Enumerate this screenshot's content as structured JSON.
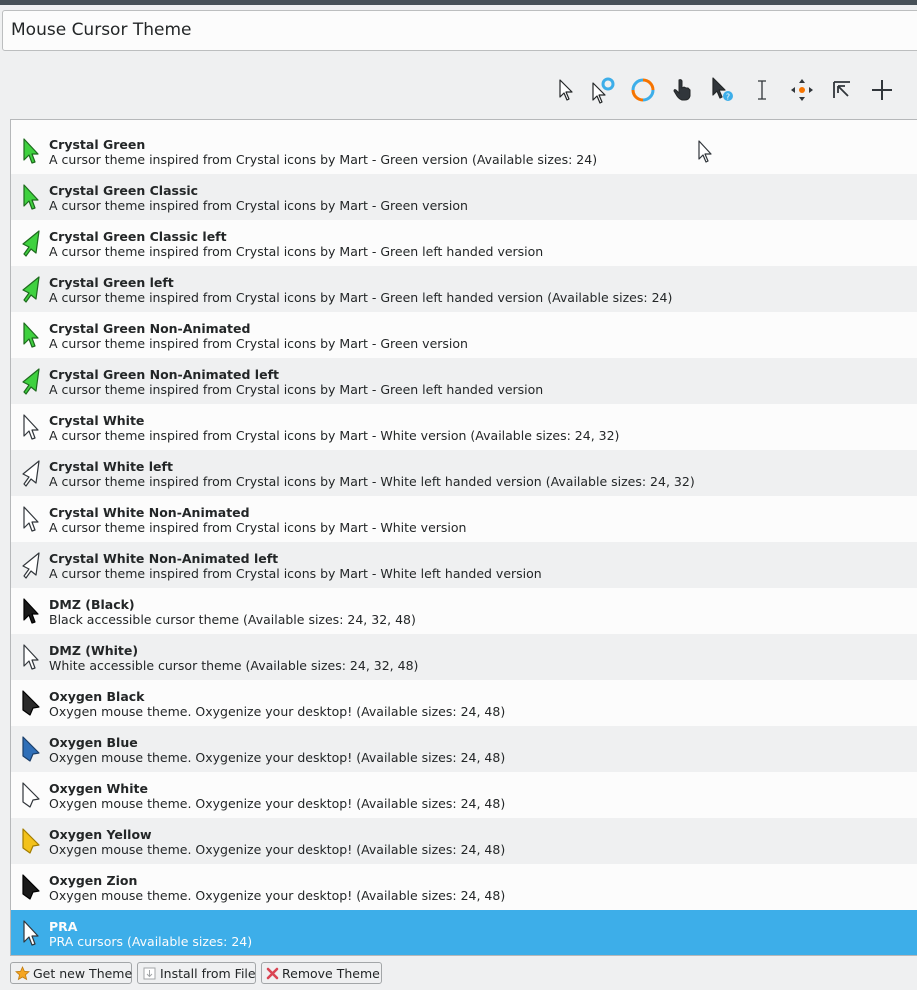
{
  "page": {
    "title": "Mouse Cursor Theme"
  },
  "preview_icons": [
    "arrow-cursor-icon",
    "busy-arrow-cursor-icon",
    "wait-spinner-icon",
    "hand-pointer-icon",
    "help-cursor-icon",
    "text-ibeam-icon",
    "move-cursor-icon",
    "corner-resize-icon",
    "crosshair-cursor-icon"
  ],
  "themes": [
    {
      "name": "Crystal Green",
      "desc": "A cursor theme inspired from Crystal icons by Mart - Green version (Available sizes: 24)",
      "icon": "green-arrow-icon"
    },
    {
      "name": "Crystal Green Classic",
      "desc": "A cursor theme inspired from Crystal icons by Mart - Green version",
      "icon": "green-arrow-icon"
    },
    {
      "name": "Crystal Green Classic left",
      "desc": "A cursor theme inspired from Crystal icons by Mart - Green left handed version",
      "icon": "green-left-arrow-icon"
    },
    {
      "name": "Crystal Green left",
      "desc": "A cursor theme inspired from Crystal icons by Mart - Green left handed version (Available sizes: 24)",
      "icon": "green-left-arrow-icon"
    },
    {
      "name": "Crystal Green Non-Animated",
      "desc": "A cursor theme inspired from Crystal icons by Mart - Green version",
      "icon": "green-arrow-icon"
    },
    {
      "name": "Crystal Green Non-Animated left",
      "desc": "A cursor theme inspired from Crystal icons by Mart - Green left handed version",
      "icon": "green-left-arrow-icon"
    },
    {
      "name": "Crystal White",
      "desc": "A cursor theme inspired from Crystal icons by Mart - White version (Available sizes: 24, 32)",
      "icon": "white-arrow-icon"
    },
    {
      "name": "Crystal White left",
      "desc": "A cursor theme inspired from Crystal icons by Mart - White left handed version (Available sizes: 24, 32)",
      "icon": "white-left-arrow-icon"
    },
    {
      "name": "Crystal White Non-Animated",
      "desc": "A cursor theme inspired from Crystal icons by Mart - White version",
      "icon": "white-arrow-icon"
    },
    {
      "name": "Crystal White Non-Animated left",
      "desc": "A cursor theme inspired from Crystal icons by Mart - White left handed version",
      "icon": "white-left-arrow-icon"
    },
    {
      "name": "DMZ (Black)",
      "desc": "Black accessible cursor theme (Available sizes: 24, 32, 48)",
      "icon": "black-arrow-icon"
    },
    {
      "name": "DMZ (White)",
      "desc": "White accessible cursor theme (Available sizes: 24, 32, 48)",
      "icon": "white-arrow-icon"
    },
    {
      "name": "Oxygen Black",
      "desc": "Oxygen mouse theme. Oxygenize your desktop! (Available sizes: 24, 48)",
      "icon": "oxygen-black-icon"
    },
    {
      "name": "Oxygen Blue",
      "desc": "Oxygen mouse theme. Oxygenize your desktop! (Available sizes: 24, 48)",
      "icon": "oxygen-blue-icon"
    },
    {
      "name": "Oxygen White",
      "desc": "Oxygen mouse theme. Oxygenize your desktop! (Available sizes: 24, 48)",
      "icon": "oxygen-white-icon"
    },
    {
      "name": "Oxygen Yellow",
      "desc": "Oxygen mouse theme. Oxygenize your desktop! (Available sizes: 24, 48)",
      "icon": "oxygen-yellow-icon"
    },
    {
      "name": "Oxygen Zion",
      "desc": "Oxygen mouse theme. Oxygenize your desktop! (Available sizes: 24, 48)",
      "icon": "oxygen-zion-icon"
    },
    {
      "name": "PRA",
      "desc": "PRA cursors (Available sizes: 24)",
      "icon": "white-arrow-icon",
      "selected": true
    }
  ],
  "buttons": {
    "get_new": "Get new Theme",
    "install": "Install from File",
    "remove": "Remove Theme"
  },
  "colors": {
    "selection": "#3daee9",
    "crystal_green": "#3fd13f",
    "oxygen_blue": "#2f6fb8",
    "oxygen_yellow": "#f3c21b"
  }
}
